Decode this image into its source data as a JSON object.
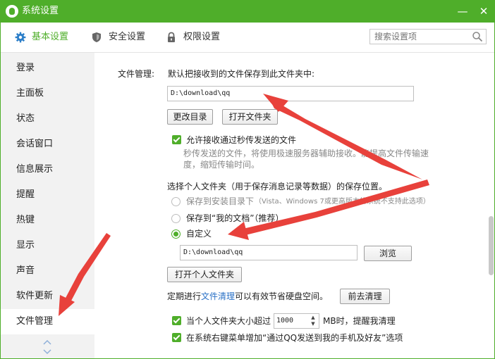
{
  "window": {
    "title": "系统设置",
    "minimize": "—",
    "close": "✕"
  },
  "tabs": [
    {
      "label": "基本设置",
      "icon": "gear-icon",
      "active": true
    },
    {
      "label": "安全设置",
      "icon": "shield-icon"
    },
    {
      "label": "权限设置",
      "icon": "lock-icon"
    }
  ],
  "search": {
    "placeholder": "搜索设置项"
  },
  "sidebar": {
    "items": [
      "登录",
      "主面板",
      "状态",
      "会话窗口",
      "信息展示",
      "提醒",
      "热键",
      "显示",
      "声音",
      "软件更新",
      "文件管理"
    ],
    "active_index": 10
  },
  "file_mgmt": {
    "section_label": "文件管理:",
    "save_desc": "默认把接收到的文件保存到此文件夹中:",
    "save_path": "D:\\download\\qq",
    "change_dir": "更改目录",
    "open_folder": "打开文件夹",
    "allow_fast_label": "允许接收通过秒传发送的文件",
    "allow_fast_desc_1": "秒传发送的文件，将使用极速服务器辅助接收。能提高文件传输速",
    "allow_fast_desc_2": "度，缩短传输时间。",
    "personal_folder_label": "选择个人文件夹（用于保存消息记录等数据）的保存位置。",
    "opt_install_dir": "保存到安装目录下",
    "opt_install_note": "（Vista、Windows 7或更高版本的系统不支持此选项）",
    "opt_my_docs": "保存到“我的文档”（推荐）",
    "opt_custom": "自定义",
    "custom_path": "D:\\download\\qq",
    "browse": "浏览",
    "open_personal": "打开个人文件夹",
    "cleanup_pre": "定期进行",
    "cleanup_link": "文件清理",
    "cleanup_post": "可以有效节省硬盘空间。",
    "cleanup_button": "前去清理",
    "size_pre": "当个人文件夹大小超过",
    "size_value": "1000",
    "size_post": "MB时，提醒我清理",
    "context_menu_label": "在系统右键菜单增加“通过QQ发送到我的手机及好友”选项"
  },
  "colors": {
    "accent": "#4fae2a",
    "arrow": "#e8413b",
    "link": "#2a71c6"
  }
}
